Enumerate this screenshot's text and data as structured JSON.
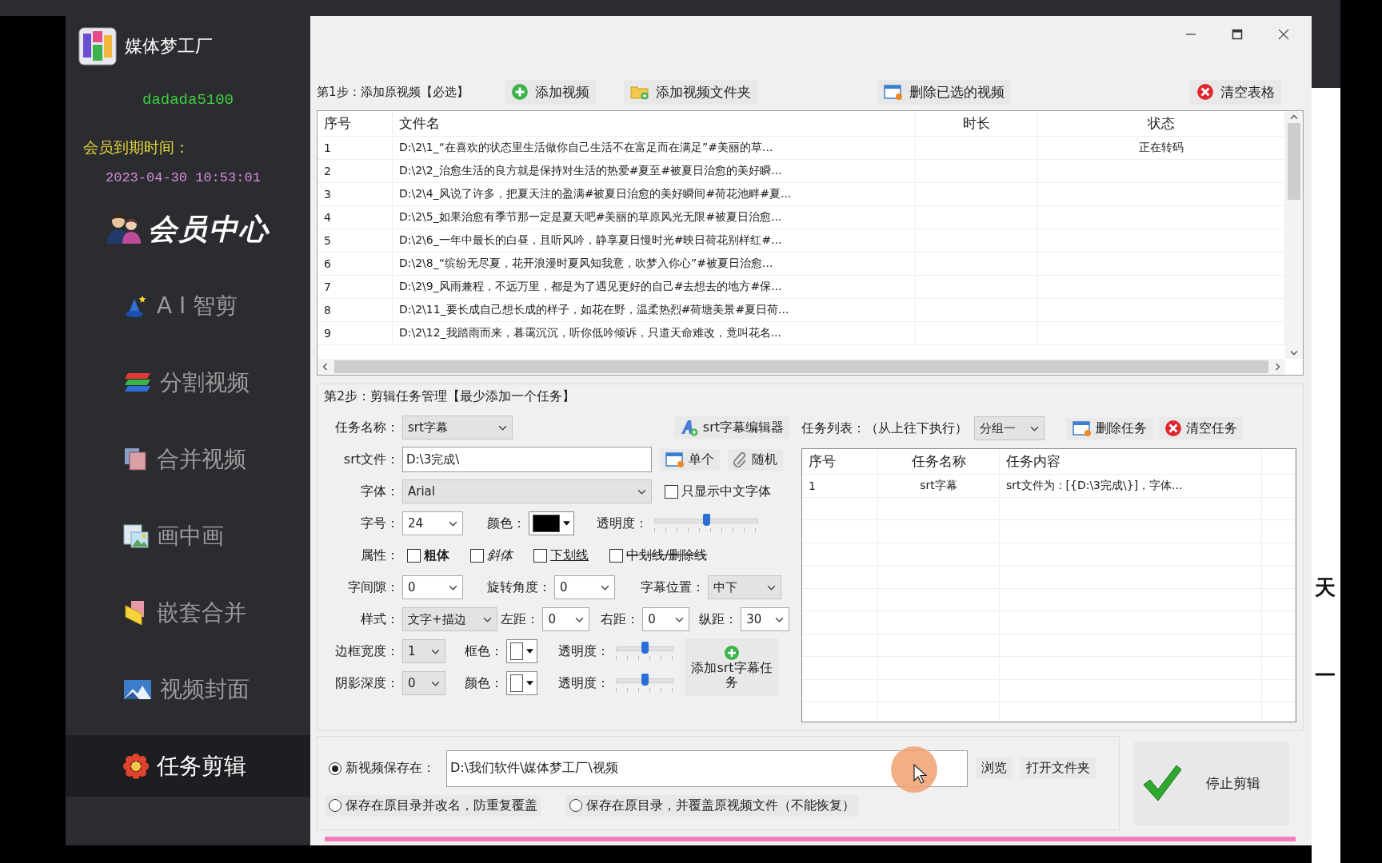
{
  "sidebar": {
    "app_name": "媒体梦工厂",
    "username": "dadada5100",
    "expiry_label": "会员到期时间：",
    "expiry_date": "2023-04-30 10:53:01",
    "member_center": "会员中心",
    "items": [
      {
        "label": "A I 智剪",
        "selected": false
      },
      {
        "label": "分割视频",
        "selected": false
      },
      {
        "label": "合并视频",
        "selected": false
      },
      {
        "label": "画中画",
        "selected": false
      },
      {
        "label": "嵌套合并",
        "selected": false
      },
      {
        "label": "视频封面",
        "selected": false
      },
      {
        "label": "任务剪辑",
        "selected": true
      }
    ]
  },
  "step1": {
    "title": "第1步：添加原视频【必选】",
    "buttons": [
      "添加视频",
      "添加视频文件夹",
      "删除已选的视频",
      "清空表格"
    ],
    "columns": [
      "序号",
      "文件名",
      "时长",
      "状态"
    ],
    "rows": [
      {
        "no": "1",
        "file": "D:\\2\\1_“在喜欢的状态里生活做你自己生活不在富足而在满足”#美丽的草...",
        "status": "正在转码"
      },
      {
        "no": "2",
        "file": "D:\\2\\2_治愈生活的良方就是保持对生活的热爱#夏至#被夏日治愈的美好瞬..."
      },
      {
        "no": "3",
        "file": "D:\\2\\4_风说了许多，把夏天注的盈满#被夏日治愈的美好瞬间#荷花池畔#夏..."
      },
      {
        "no": "4",
        "file": "D:\\2\\5_如果治愈有季节那一定是夏天吧#美丽的草原风光无限#被夏日治愈..."
      },
      {
        "no": "5",
        "file": "D:\\2\\6_一年中最长的白昼，且听风吟，静享夏日慢时光#映日荷花别样红#..."
      },
      {
        "no": "6",
        "file": "D:\\2\\8_“缤纷无尽夏，花开浪漫时夏风知我意，吹梦入你心”#被夏日治愈..."
      },
      {
        "no": "7",
        "file": "D:\\2\\9_风雨兼程，不远万里，都是为了遇见更好的自己#去想去的地方#保..."
      },
      {
        "no": "8",
        "file": "D:\\2\\11_要长成自己想长成的样子，如花在野，温柔热烈#荷塘美景#夏日荷..."
      },
      {
        "no": "9",
        "file": "D:\\2\\12_我踏雨而来，暮霭沉沉，听你低吟倾诉，只道天命难改，竟叫花名..."
      }
    ]
  },
  "step2": {
    "title": "第2步：剪辑任务管理【最少添加一个任务】",
    "task_name": {
      "label": "任务名称：",
      "value": "srt字幕",
      "editable": false
    },
    "editor_button": "srt字幕编辑器",
    "srt_file": {
      "label": "srt文件：",
      "value": "D:\\3完成\\"
    },
    "single_button": "单个",
    "random_button": "随机",
    "font": {
      "label": "字体：",
      "value": "Arial",
      "editable": false
    },
    "chinese_only": {
      "label": "只显示中文字体",
      "checked": false
    },
    "size": {
      "label": "字号：",
      "value": "24",
      "editable": true
    },
    "color": {
      "label": "颜色：",
      "color": "#000000"
    },
    "opacity": {
      "label": "透明度：",
      "level": 0.5
    },
    "attributes_label": "属性：",
    "attributes": [
      {
        "label": "粗体",
        "kind": "bold",
        "checked": false
      },
      {
        "label": "斜体",
        "kind": "italic",
        "checked": false
      },
      {
        "label": "下划线",
        "kind": "underline",
        "checked": false
      },
      {
        "label": "中划线/删除线",
        "kind": "strike",
        "checked": false
      }
    ],
    "spacing": {
      "label": "字间隙：",
      "value": "0",
      "editable": true
    },
    "rotation": {
      "label": "旋转角度：",
      "value": "0",
      "editable": true
    },
    "position": {
      "label": "字幕位置：",
      "value": "中下",
      "editable": false
    },
    "style": {
      "label": "样式：",
      "value": "文字+描边",
      "editable": false
    },
    "left": {
      "label": "左距：",
      "value": "0",
      "editable": true
    },
    "right": {
      "label": "右距：",
      "value": "0",
      "editable": true
    },
    "vertical": {
      "label": "纵距：",
      "value": "30",
      "editable": true
    },
    "border_width": {
      "label": "边框宽度：",
      "value": "1",
      "editable": false
    },
    "border_color": {
      "label": "框色：",
      "color": "#ffffff"
    },
    "border_opacity": {
      "label": "透明度：",
      "level": 0.5
    },
    "shadow_depth": {
      "label": "阴影深度：",
      "value": "0",
      "editable": false
    },
    "shadow_color": {
      "label": "颜色：",
      "color": "#ffffff"
    },
    "shadow_opacity": {
      "label": "透明度：",
      "level": 0.5
    },
    "add_button": "添加srt字幕任务",
    "task_list": {
      "label": "任务列表：（从上往下执行）",
      "group": {
        "value": "分组一",
        "editable": false
      },
      "delete_button": "删除任务",
      "clear_button": "清空任务",
      "columns": [
        "序号",
        "任务名称",
        "任务内容"
      ],
      "rows": [
        {
          "no": "1",
          "name": "srt字幕",
          "content": "srt文件为：[{D:\\3完成\\}]，字体..."
        }
      ]
    }
  },
  "output": {
    "options": [
      {
        "label": "新视频保存在：",
        "selected": true
      },
      {
        "label": "保存在原目录并改名，防重复覆盖",
        "selected": false
      },
      {
        "label": "保存在原目录，并覆盖原视频文件（不能恢复）",
        "selected": false
      }
    ],
    "path": "D:\\我们软件\\媒体梦工厂\\视频",
    "browse_button": "浏览",
    "open_button": "打开文件夹",
    "stop_button": "停止剪辑"
  },
  "progress": {
    "level": 1
  },
  "background_page": {
    "texts": [
      "天",
      "一"
    ]
  }
}
